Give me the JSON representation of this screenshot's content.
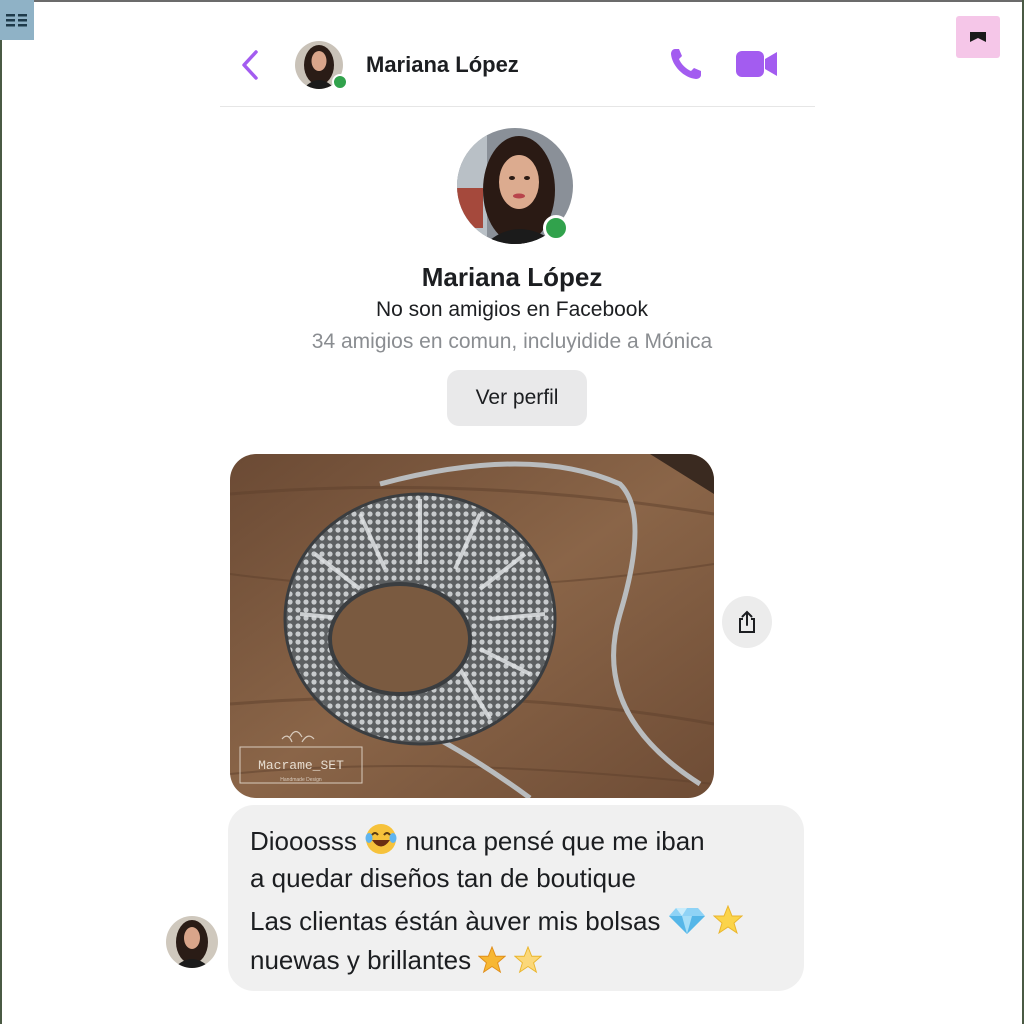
{
  "contact": {
    "name": "Mariana López",
    "online": true
  },
  "profile": {
    "name": "Mariana López",
    "relationship": "No son amigios en Facebook",
    "mutual_friends": "34 amigios en comun, incluyidide a Mónica",
    "view_profile_label": "Ver perfil"
  },
  "photo": {
    "watermark_brand": "Macrame_SET",
    "watermark_sub": "Handmade Design"
  },
  "message": {
    "line1_a": "Diooosss",
    "line1_b": "nunca pensé que me iban",
    "line2": "a quedar diseños tan de boutique",
    "line3": "Las clientas éstán àuver mis bolsas",
    "line4": "nuewas y brillantes"
  },
  "colors": {
    "accent": "#a35cf0",
    "online": "#31a24c",
    "bubble": "#f0f0f0",
    "secondary_text": "#8a8d91"
  },
  "icons": {
    "back": "chevron-left-icon",
    "call": "phone-icon",
    "video": "video-camera-icon",
    "share": "share-icon",
    "corner_left": "menu-icon",
    "corner_right": "bookmark-icon"
  }
}
